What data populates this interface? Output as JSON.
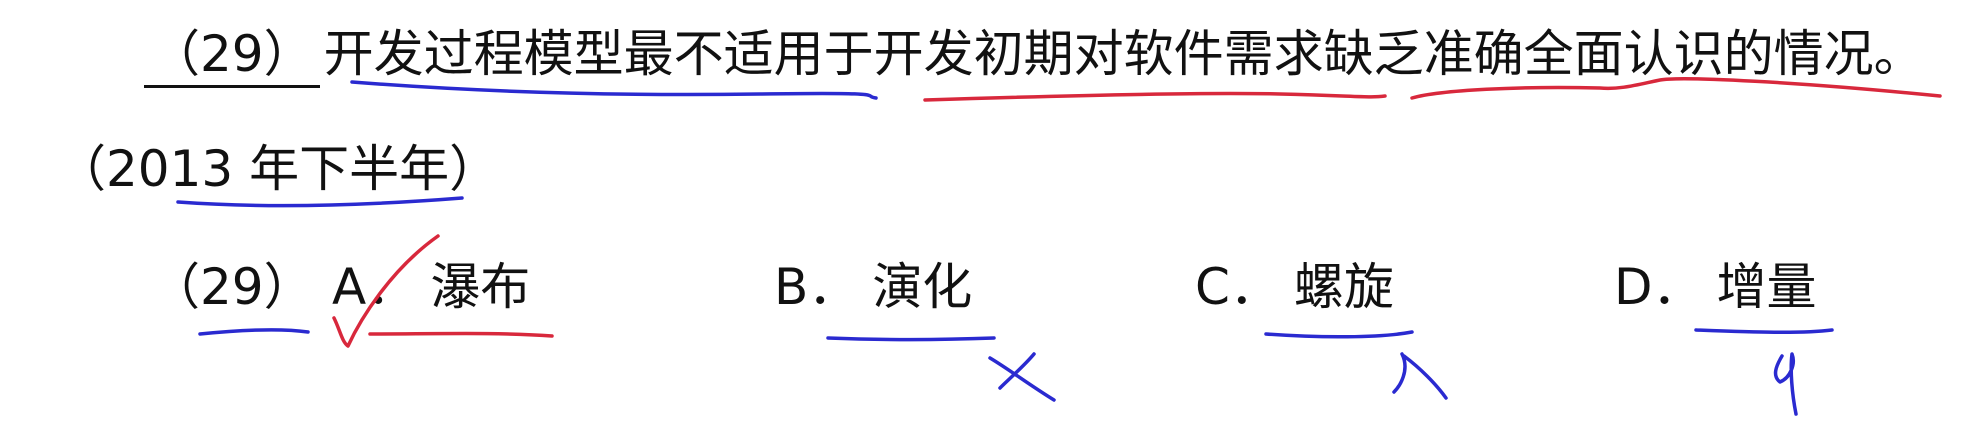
{
  "question": {
    "number_blank": "（29）",
    "text": "开发过程模型最不适用于开发初期对软件需求缺乏准确全面认识的情况。"
  },
  "source": {
    "text": "（2013 年下半年）"
  },
  "options": {
    "number": "（29）",
    "items": [
      {
        "letter": "A．",
        "text": "瀑布",
        "mark": "check"
      },
      {
        "letter": "B．",
        "text": "演化",
        "mark": "cross"
      },
      {
        "letter": "C．",
        "text": "螺旋",
        "mark": "cross"
      },
      {
        "letter": "D．",
        "text": "增量",
        "mark": "cross"
      }
    ]
  },
  "ink_colors": {
    "blue": "#2a2ad0",
    "red": "#d8283c"
  }
}
